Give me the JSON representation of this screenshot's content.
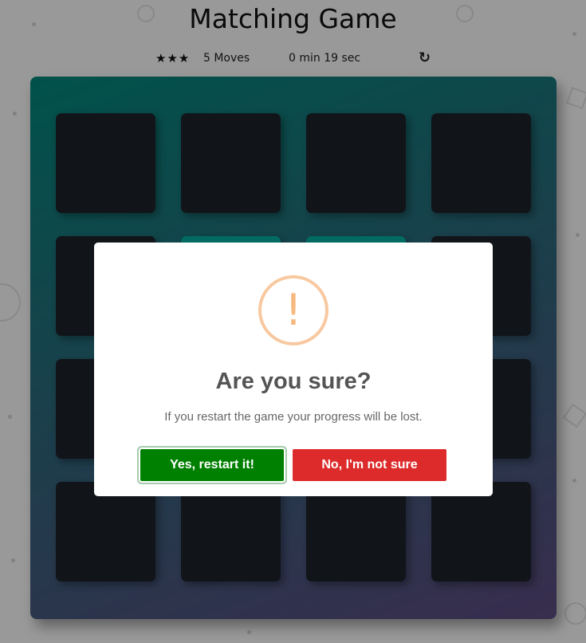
{
  "game": {
    "title": "Matching Game",
    "stars": "★★★",
    "star_rating": 3,
    "moves_label": "5 Moves",
    "timer_label": "0 min 19 sec",
    "restart_icon": "↻"
  },
  "deck": {
    "accent_start": "#02897d",
    "accent_end": "#5f4c82",
    "card_color": "#1d232b",
    "open_card_color": "#02b3a4"
  },
  "modal": {
    "icon": "!",
    "title": "Are you sure?",
    "text": "If you restart the game your progress will be lost.",
    "confirm_label": "Yes, restart it!",
    "cancel_label": "No, I'm not sure",
    "confirm_color": "#008000",
    "cancel_color": "#dd2b2b"
  }
}
